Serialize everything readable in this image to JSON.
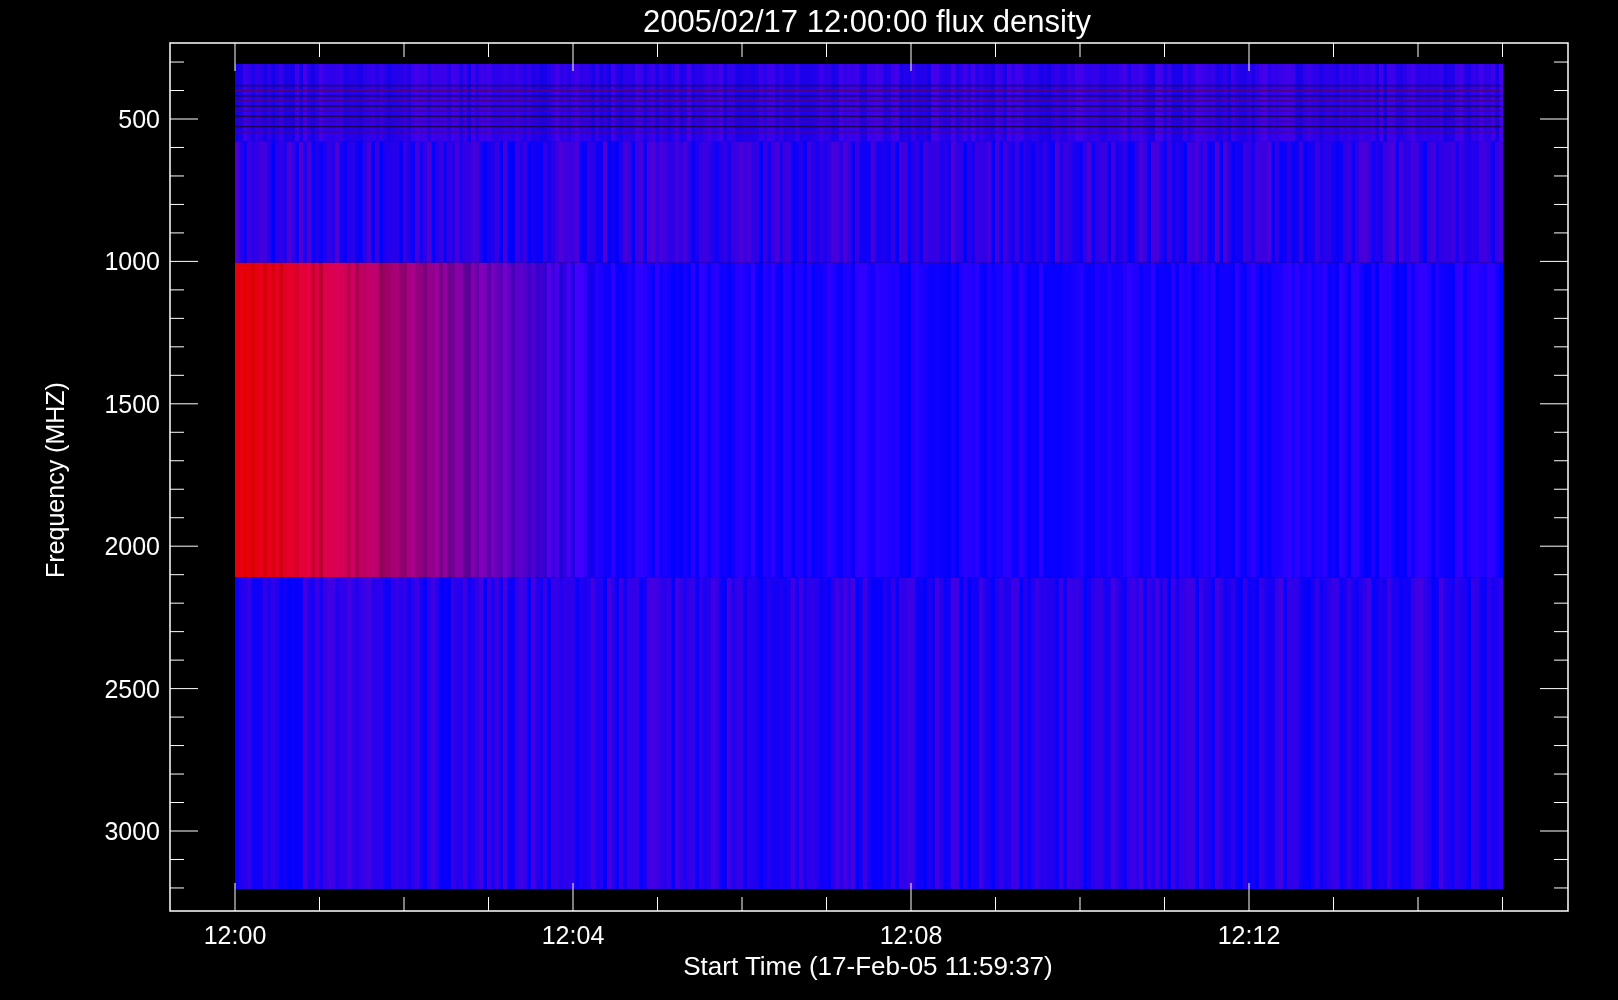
{
  "plot": {
    "title": "2005/02/17 12:00:00 flux density",
    "xlabel": "Start Time (17-Feb-05 11:59:37)",
    "ylabel": "Frequency (MHZ)",
    "yticks": [
      "500",
      "1000",
      "1500",
      "2000",
      "2500",
      "3000"
    ],
    "xticks": [
      "12:00",
      "12:04",
      "12:08",
      "12:12"
    ]
  }
}
